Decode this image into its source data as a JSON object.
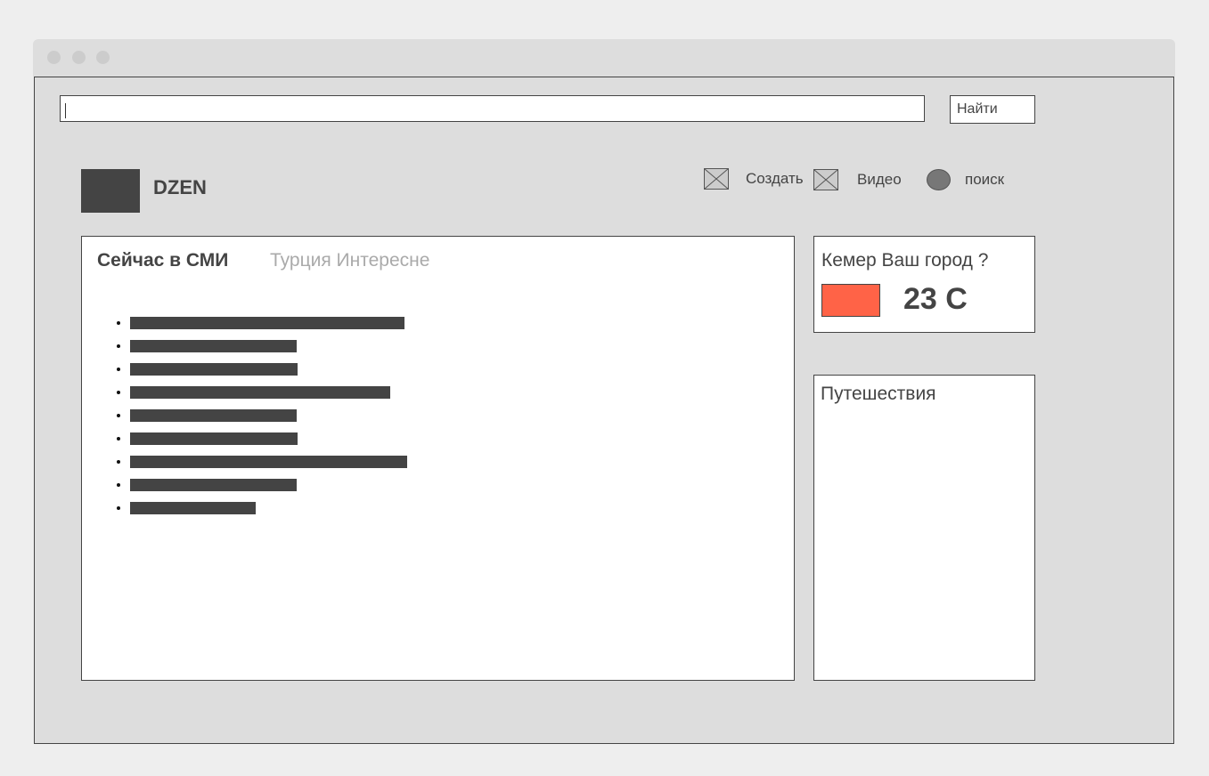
{
  "search": {
    "value": "",
    "button_label": "Найти"
  },
  "brand": {
    "name": "DZEN"
  },
  "nav": {
    "items": [
      {
        "label": "Создать",
        "icon": "image-placeholder-icon"
      },
      {
        "label": "Видео",
        "icon": "image-placeholder-icon"
      },
      {
        "label": "поиск",
        "icon": "circle-icon"
      }
    ]
  },
  "main": {
    "tabs": [
      {
        "label": "Сейчас в СМИ",
        "active": true
      },
      {
        "label": "Турция Интересне",
        "active": false
      }
    ],
    "news_count": 9
  },
  "weather": {
    "question": "Кемер Ваш город ?",
    "temperature": "23 C",
    "swatch_color": "#ff6347"
  },
  "travel": {
    "title": "Путешествия"
  }
}
